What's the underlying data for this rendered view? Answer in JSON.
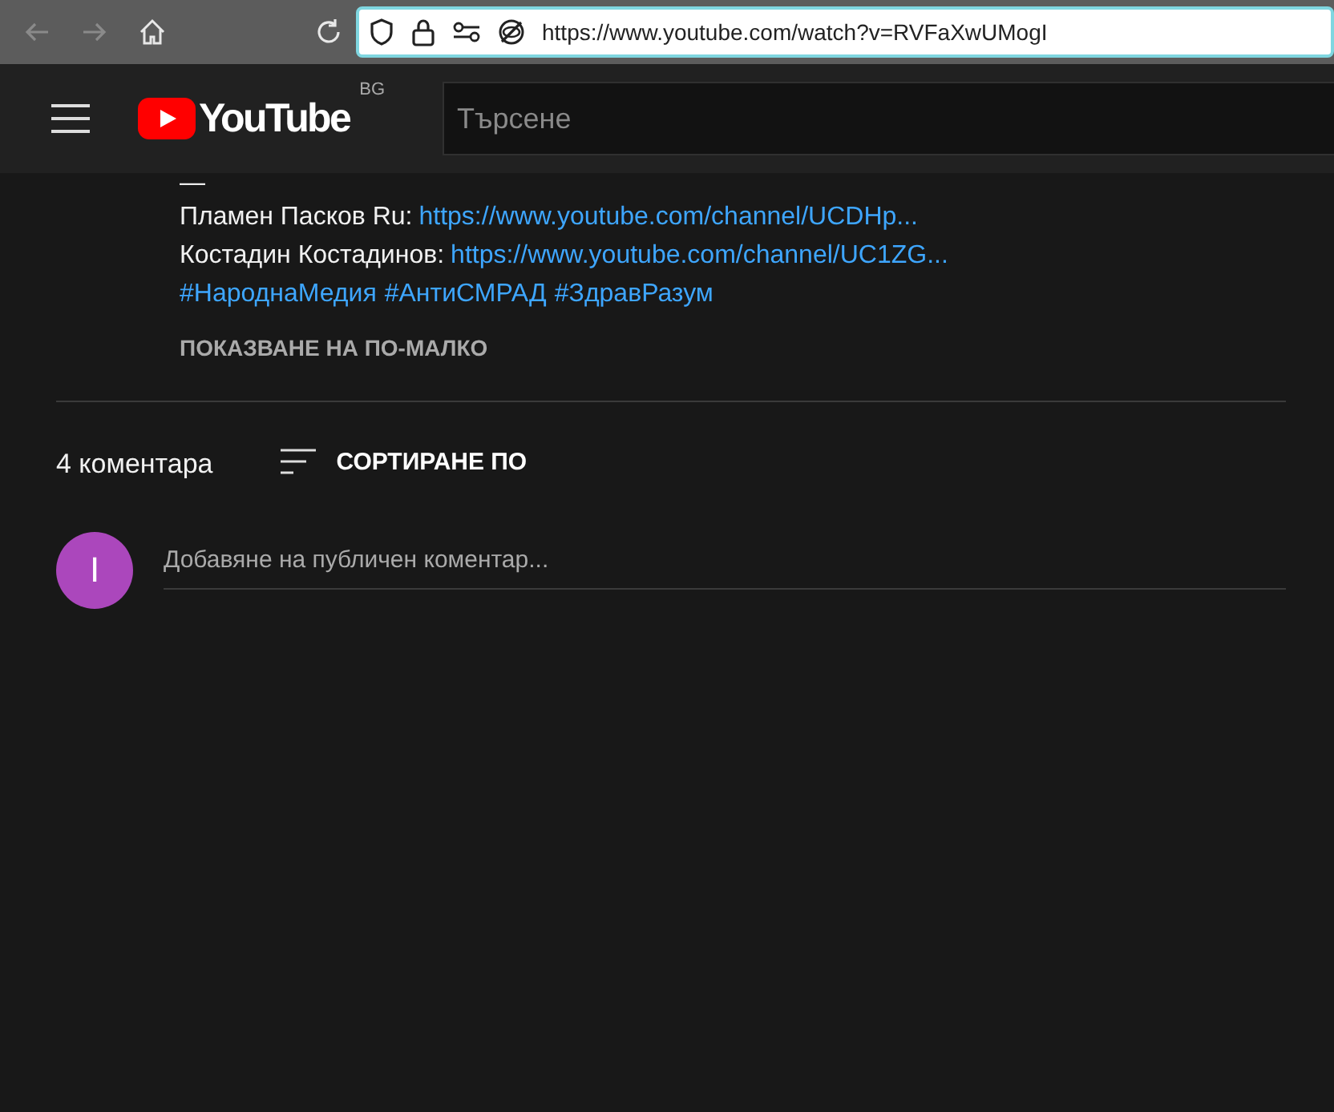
{
  "browser": {
    "url": "https://www.youtube.com/watch?v=RVFaXwUMogI"
  },
  "header": {
    "logo_text": "YouTube",
    "region": "BG",
    "search": {
      "placeholder": "Търсене"
    }
  },
  "description": {
    "separator": "—",
    "lines": [
      {
        "label": "Пламен Пасков Ru:",
        "link": "https://www.youtube.com/channel/UCDHp..."
      },
      {
        "label": "Костадин Костадинов:",
        "link": "https://www.youtube.com/channel/UC1ZG..."
      }
    ],
    "hashtags": [
      "#НароднаМедия",
      "#АнтиСМРАД",
      "#ЗдравРазум"
    ],
    "show_less": "ПОКАЗВАНЕ НА ПО-МАЛКО"
  },
  "comments": {
    "count": "4 коментара",
    "sort": "СОРТИРАНЕ ПО",
    "avatar": "I",
    "input": {
      "placeholder": "Добавяне на публичен коментар..."
    }
  }
}
